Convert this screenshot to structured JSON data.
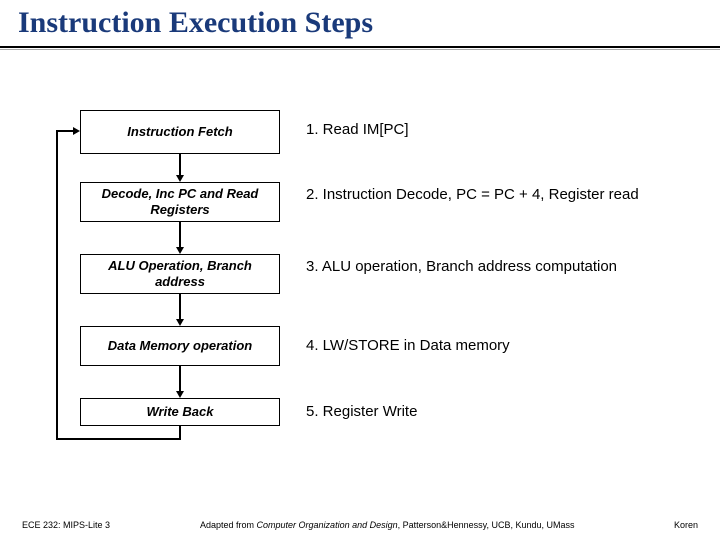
{
  "title": "Instruction Execution Steps",
  "steps": [
    {
      "box": "Instruction Fetch",
      "desc": "1. Read IM[PC]"
    },
    {
      "box": "Decode, Inc PC and Read Registers",
      "desc": "2. Instruction Decode, PC = PC + 4, Register read"
    },
    {
      "box": "ALU Operation, Branch address",
      "desc": "3. ALU operation, Branch address computation"
    },
    {
      "box": "Data Memory operation",
      "desc": "4. LW/STORE in Data memory"
    },
    {
      "box": "Write Back",
      "desc": "5. Register Write"
    }
  ],
  "footer": {
    "left": "ECE 232: MIPS-Lite 3",
    "mid_prefix": "Adapted from ",
    "mid_italic": "Computer Organization and Design",
    "mid_suffix": ", Patterson&Hennessy, UCB, Kundu, UMass",
    "right": "Koren"
  }
}
